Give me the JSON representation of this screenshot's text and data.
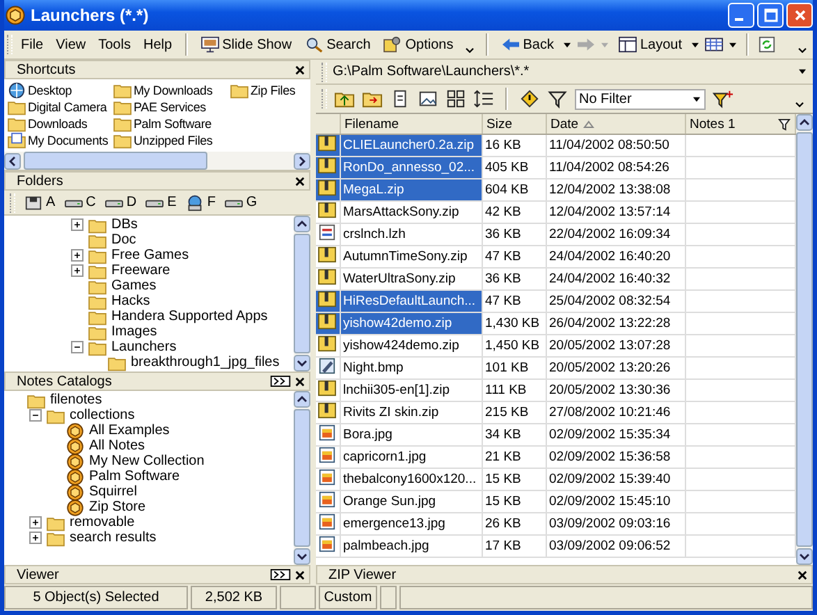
{
  "window": {
    "title": "Launchers (*.*)"
  },
  "menu": [
    "File",
    "View",
    "Tools",
    "Help"
  ],
  "toolbar": [
    {
      "kind": "slideshow",
      "label": "Slide Show"
    },
    {
      "kind": "search",
      "label": "Search"
    },
    {
      "kind": "options",
      "label": "Options"
    }
  ],
  "nav": {
    "back": {
      "label": "Back"
    },
    "forward": {
      "disabled": true
    },
    "layout": {
      "label": "Layout"
    }
  },
  "shortcuts": {
    "title": "Shortcuts",
    "items": [
      {
        "kind": "desktop",
        "label": "Desktop"
      },
      {
        "kind": "folder",
        "label": "Digital Camera"
      },
      {
        "kind": "folder",
        "label": "Downloads"
      },
      {
        "kind": "document",
        "label": "My Documents"
      },
      {
        "kind": "folder",
        "label": "My Downloads"
      },
      {
        "kind": "folder",
        "label": "PAE Services"
      },
      {
        "kind": "folder",
        "label": "Palm Software"
      },
      {
        "kind": "folder",
        "label": "Unzipped Files"
      },
      {
        "kind": "folder",
        "label": "Zip Files"
      }
    ]
  },
  "folders": {
    "title": "Folders",
    "drives": [
      {
        "kind": "floppy",
        "label": "A"
      },
      {
        "kind": "disk",
        "label": "C"
      },
      {
        "kind": "disk",
        "label": "D"
      },
      {
        "kind": "disk",
        "label": "E"
      },
      {
        "kind": "network",
        "label": "F"
      },
      {
        "kind": "disk",
        "label": "G"
      }
    ],
    "tree": [
      {
        "label": "DBs",
        "expanded": false
      },
      {
        "label": "Doc"
      },
      {
        "label": "Free Games",
        "expanded": false
      },
      {
        "label": "Freeware",
        "expanded": false
      },
      {
        "label": "Games"
      },
      {
        "label": "Hacks"
      },
      {
        "label": "Handera Supported Apps"
      },
      {
        "label": "Images"
      },
      {
        "label": "Launchers",
        "expanded": true,
        "children": [
          {
            "label": "breakthrough1_jpg_files"
          }
        ]
      }
    ]
  },
  "notes_catalogs": {
    "title": "Notes Catalogs",
    "tree": [
      {
        "kind": "folder",
        "label": "filenotes",
        "children": [
          {
            "kind": "folder",
            "label": "collections",
            "expanded": true,
            "children": [
              {
                "kind": "collection",
                "label": "All Examples"
              },
              {
                "kind": "collection",
                "label": "All Notes"
              },
              {
                "kind": "collection",
                "label": "My New Collection"
              },
              {
                "kind": "collection",
                "label": "Palm Software"
              },
              {
                "kind": "collection",
                "label": "Squirrel"
              },
              {
                "kind": "collection",
                "label": "Zip Store"
              }
            ]
          },
          {
            "kind": "folder",
            "label": "removable",
            "expanded": false
          },
          {
            "kind": "folder",
            "label": "search results",
            "expanded": false
          }
        ]
      }
    ]
  },
  "viewer": {
    "title": "Viewer"
  },
  "path": "G:\\Palm Software\\Launchers\\*.*",
  "filter": "No Filter",
  "table": {
    "columns": [
      "Filename",
      "Size",
      "Date",
      "Notes 1"
    ],
    "rows": [
      {
        "kind": "zip",
        "filename": "CLIELauncher0.2a.zip",
        "size": "16 KB",
        "date": "11/04/2002 08:50:50",
        "selected": true
      },
      {
        "kind": "zip",
        "filename": "RonDo_annesso_02...",
        "size": "405 KB",
        "date": "11/04/2002 08:54:26",
        "selected": true
      },
      {
        "kind": "zip",
        "filename": "MegaL.zip",
        "size": "604 KB",
        "date": "12/04/2002 13:38:08",
        "selected": true
      },
      {
        "kind": "zip",
        "filename": "MarsAttackSony.zip",
        "size": "42 KB",
        "date": "12/04/2002 13:57:14",
        "selected": false
      },
      {
        "kind": "lzh",
        "filename": "crslnch.lzh",
        "size": "36 KB",
        "date": "22/04/2002 16:09:34",
        "selected": false
      },
      {
        "kind": "zip",
        "filename": "AutumnTimeSony.zip",
        "size": "47 KB",
        "date": "24/04/2002 16:40:20",
        "selected": false
      },
      {
        "kind": "zip",
        "filename": "WaterUltraSony.zip",
        "size": "36 KB",
        "date": "24/04/2002 16:40:32",
        "selected": false
      },
      {
        "kind": "zip",
        "filename": "HiResDefaultLaunch...",
        "size": "47 KB",
        "date": "25/04/2002 08:32:54",
        "selected": true
      },
      {
        "kind": "zip",
        "filename": "yishow42demo.zip",
        "size": "1,430 KB",
        "date": "26/04/2002 13:22:28",
        "selected": true
      },
      {
        "kind": "zip",
        "filename": "yishow424demo.zip",
        "size": "1,450 KB",
        "date": "20/05/2002 13:07:28",
        "selected": false
      },
      {
        "kind": "bmp",
        "filename": "Night.bmp",
        "size": "101 KB",
        "date": "20/05/2002 13:20:26",
        "selected": false
      },
      {
        "kind": "zip",
        "filename": "lnchii305-en[1].zip",
        "size": "111 KB",
        "date": "20/05/2002 13:30:36",
        "selected": false
      },
      {
        "kind": "zip",
        "filename": "Rivits ZI skin.zip",
        "size": "215 KB",
        "date": "27/08/2002 10:21:46",
        "selected": false
      },
      {
        "kind": "jpg",
        "filename": "Bora.jpg",
        "size": "34 KB",
        "date": "02/09/2002 15:35:34",
        "selected": false
      },
      {
        "kind": "jpg",
        "filename": "capricorn1.jpg",
        "size": "21 KB",
        "date": "02/09/2002 15:36:58",
        "selected": false
      },
      {
        "kind": "jpg",
        "filename": "thebalcony1600x120...",
        "size": "15 KB",
        "date": "02/09/2002 15:39:40",
        "selected": false
      },
      {
        "kind": "jpg",
        "filename": "Orange Sun.jpg",
        "size": "15 KB",
        "date": "02/09/2002 15:45:10",
        "selected": false
      },
      {
        "kind": "jpg",
        "filename": "emergence13.jpg",
        "size": "26 KB",
        "date": "03/09/2002 09:03:16",
        "selected": false
      },
      {
        "kind": "jpg",
        "filename": "palmbeach.jpg",
        "size": "17 KB",
        "date": "03/09/2002 09:06:52",
        "selected": false
      }
    ]
  },
  "zip_viewer": {
    "title": "ZIP Viewer"
  },
  "status_bar": [
    "5 Object(s) Selected",
    "2,502 KB",
    "Custom"
  ]
}
